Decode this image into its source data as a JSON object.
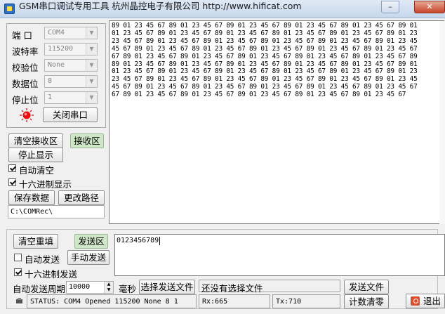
{
  "window": {
    "title": "GSM串口调试专用工具 杭州晶控电子有限公司 http://www.hificat.com",
    "minimize_label": "–",
    "close_label": "✕"
  },
  "port_settings": {
    "port_label": "端  口",
    "port_value": "COM4",
    "baud_label": "波特率",
    "baud_value": "115200",
    "parity_label": "校验位",
    "parity_value": "None",
    "databits_label": "数据位",
    "databits_value": "8",
    "stopbits_label": "停止位",
    "stopbits_value": "1",
    "close_port_button": "关闭串口",
    "led_icon": "red-led-icon"
  },
  "receive_controls": {
    "clear_receive_button": "清空接收区",
    "receive_area_button": "接收区",
    "stop_display_button": "停止显示",
    "auto_clear_label": "自动清空",
    "auto_clear_checked": true,
    "hex_display_label": "十六进制显示",
    "hex_display_checked": true,
    "save_data_button": "保存数据",
    "change_path_button": "更改路径",
    "save_path": "C:\\COMRec\\"
  },
  "receive_area": {
    "lines": [
      "89 01 23 45 67 89 01 23 45 67 89 01 23 45 67 89 01 23 45 67 89 01 23 45 67 89 01",
      "01 23 45 67 89 01 23 45 67 89 01 23 45 67 89 01 23 45 67 89 01 23 45 67 89 01 23",
      "23 45 67 89 01 23 45 67 89 01 23 45 67 89 01 23 45 67 89 01 23 45 67 89 01 23 45",
      "45 67 89 01 23 45 67 89 01 23 45 67 89 01 23 45 67 89 01 23 45 67 89 01 23 45 67",
      "67 89 01 23 45 67 89 01 23 45 67 89 01 23 45 67 89 01 23 45 67 89 01 23 45 67 89",
      "89 01 23 45 67 89 01 23 45 67 89 01 23 45 67 89 01 23 45 67 89 01 23 45 67 89 01",
      "01 23 45 67 89 01 23 45 67 89 01 23 45 67 89 01 23 45 67 89 01 23 45 67 89 01 23",
      "23 45 67 89 01 23 45 67 89 01 23 45 67 89 01 23 45 67 89 01 23 45 67 89 01 23 45",
      "45 67 89 01 23 45 67 89 01 23 45 67 89 01 23 45 67 89 01 23 45 67 89 01 23 45 67",
      "67 89 01 23 45 67 89 01 23 45 67 89 01 23 45 67 89 01 23 45 67 89 01 23 45 67"
    ]
  },
  "send_controls": {
    "clear_resend_button": "清空重填",
    "send_area_button": "发送区",
    "auto_send_label": "自动发送",
    "auto_send_checked": false,
    "manual_send_button": "手动发送",
    "hex_send_label": "十六进制发送",
    "hex_send_checked": true,
    "send_text": "0123456789",
    "auto_send_period_label": "自动发送周期",
    "period_value": "10000",
    "ms_label": "毫秒",
    "choose_file_button": "选择发送文件",
    "file_status": "还没有选择文件",
    "send_file_button": "发送文件",
    "reset_count_button": "计数清零",
    "exit_button": "退出"
  },
  "status_bar": {
    "status": "STATUS: COM4 Opened 115200 None 8 1",
    "rx": "Rx:665",
    "tx": "Tx:710"
  }
}
